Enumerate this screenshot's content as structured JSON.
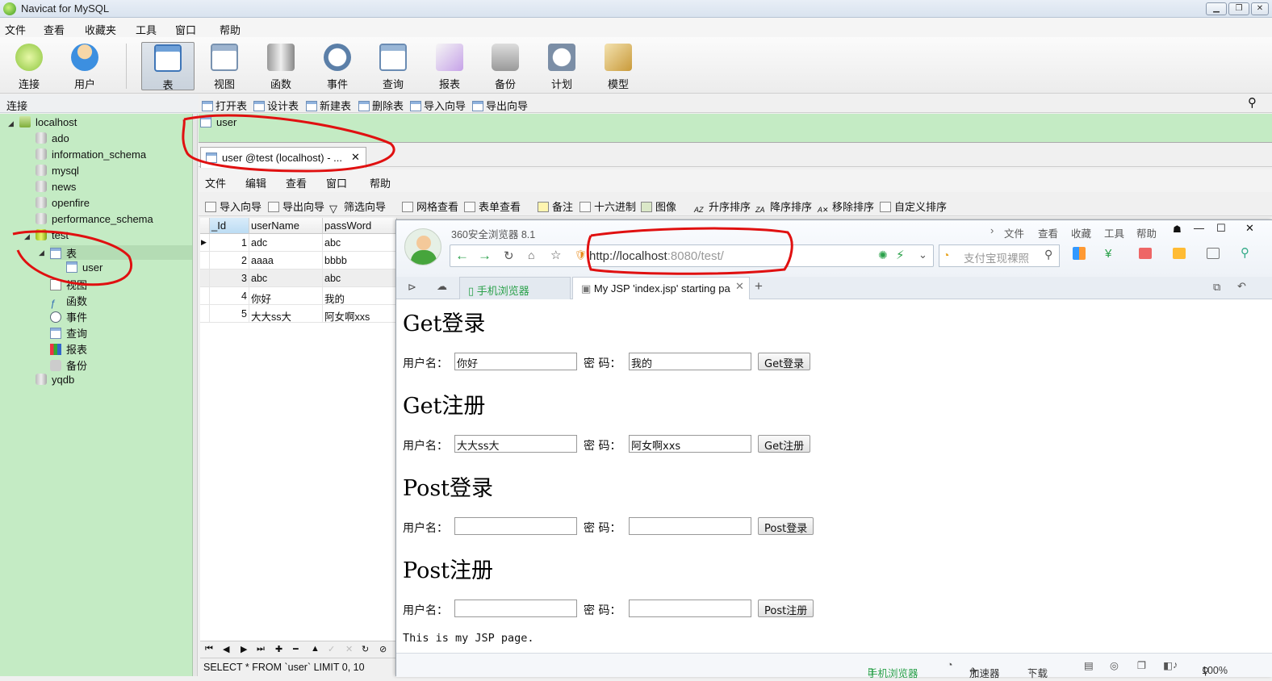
{
  "app": {
    "title": "Navicat for MySQL"
  },
  "menu": [
    "文件",
    "查看",
    "收藏夹",
    "工具",
    "窗口",
    "帮助"
  ],
  "big_toolbar": [
    {
      "label": "连接",
      "icon": "connection-icon"
    },
    {
      "label": "用户",
      "icon": "user-icon"
    },
    {
      "label": "表",
      "icon": "table-icon",
      "selected": true
    },
    {
      "label": "视图",
      "icon": "view-icon"
    },
    {
      "label": "函数",
      "icon": "function-icon"
    },
    {
      "label": "事件",
      "icon": "event-icon"
    },
    {
      "label": "查询",
      "icon": "query-icon"
    },
    {
      "label": "报表",
      "icon": "report-icon"
    },
    {
      "label": "备份",
      "icon": "backup-icon"
    },
    {
      "label": "计划",
      "icon": "schedule-icon"
    },
    {
      "label": "模型",
      "icon": "model-icon"
    }
  ],
  "left_panel": {
    "label": "连接"
  },
  "tree": {
    "root": "localhost",
    "databases": [
      "ado",
      "information_schema",
      "mysql",
      "news",
      "openfire",
      "performance_schema"
    ],
    "open_db": "test",
    "tables_node": "表",
    "table": "user",
    "children": [
      "视图",
      "函数",
      "事件",
      "查询",
      "报表",
      "备份"
    ],
    "last_db": "yqdb"
  },
  "object_toolbar": [
    "打开表",
    "设计表",
    "新建表",
    "删除表",
    "导入向导",
    "导出向导"
  ],
  "object_list": [
    "user"
  ],
  "doc_tab": {
    "title": "user @test (localhost) - ...",
    "close": "✕"
  },
  "sub_menu": [
    "文件",
    "编辑",
    "查看",
    "窗口",
    "帮助"
  ],
  "sub_toolbar": [
    "导入向导",
    "导出向导",
    "筛选向导",
    "网格查看",
    "表单查看",
    "备注",
    "十六进制",
    "图像",
    "升序排序",
    "降序排序",
    "移除排序",
    "自定义排序"
  ],
  "grid": {
    "columns": [
      "_Id",
      "userName",
      "passWord"
    ],
    "rows": [
      [
        "1",
        "adc",
        "abc"
      ],
      [
        "2",
        "aaaa",
        "bbbb"
      ],
      [
        "3",
        "abc",
        "abc"
      ],
      [
        "4",
        "你好",
        "我的"
      ],
      [
        "5",
        "大大ss大",
        "阿女啊xxs"
      ]
    ]
  },
  "sql": "SELECT * FROM `user` LIMIT 0, 10",
  "browser": {
    "title": "360安全浏览器 8.1",
    "menu": [
      "文件",
      "查看",
      "收藏",
      "工具",
      "帮助"
    ],
    "url_host": "http://localhost",
    "url_rest": ":8080/test/",
    "search_placeholder": "支付宝现裸照",
    "tabs": [
      {
        "label": "手机浏览器"
      },
      {
        "label": "My JSP 'index.jsp' starting pa"
      }
    ],
    "new_tab": "+",
    "status": [
      "手机浏览器",
      "加速器",
      "下载",
      "100%"
    ]
  },
  "page": {
    "sections": [
      {
        "heading": "Get登录",
        "user_label": "用户名：",
        "pass_label": "密 码：",
        "user": "你好",
        "pass": "我的",
        "button": "Get登录"
      },
      {
        "heading": "Get注册",
        "user_label": "用户名：",
        "pass_label": "密 码：",
        "user": "大大ss大",
        "pass": "阿女啊xxs",
        "button": "Get注册"
      },
      {
        "heading": "Post登录",
        "user_label": "用户名：",
        "pass_label": "密 码：",
        "user": "",
        "pass": "",
        "button": "Post登录"
      },
      {
        "heading": "Post注册",
        "user_label": "用户名：",
        "pass_label": "密 码：",
        "user": "",
        "pass": "",
        "button": "Post注册"
      }
    ],
    "footer": "This is my JSP page."
  }
}
